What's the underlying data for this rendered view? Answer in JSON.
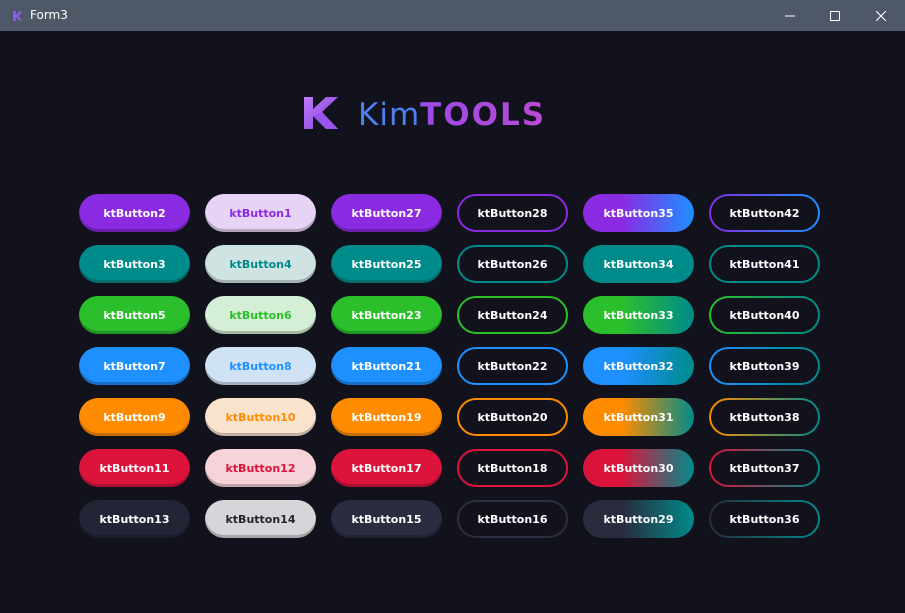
{
  "window": {
    "title": "Form3",
    "icon": "app-icon",
    "controls": [
      "minimize-icon",
      "maximize-icon",
      "close-icon"
    ]
  },
  "logo": {
    "part1": "Kim",
    "part2": "TOOLS",
    "colors": {
      "kim": "#4f7ff0",
      "tools_start": "#9a4ae6",
      "tools_end": "#b84bd4"
    }
  },
  "palette": {
    "purple": "#8a2be2",
    "teal": "#008b8b",
    "green": "#2cbf2c",
    "blue": "#1e90ff",
    "orange": "#ff8c00",
    "crimson": "#dc143c",
    "dark": "#2a2b3d"
  },
  "buttons": [
    [
      "ktButton2",
      "ktButton1",
      "ktButton27",
      "ktButton28",
      "ktButton35",
      "ktButton42"
    ],
    [
      "ktButton3",
      "ktButton4",
      "ktButton25",
      "ktButton26",
      "ktButton34",
      "ktButton41"
    ],
    [
      "ktButton5",
      "ktButton6",
      "ktButton23",
      "ktButton24",
      "ktButton33",
      "ktButton40"
    ],
    [
      "ktButton7",
      "ktButton8",
      "ktButton21",
      "ktButton22",
      "ktButton32",
      "ktButton39"
    ],
    [
      "ktButton9",
      "ktButton10",
      "ktButton19",
      "ktButton20",
      "ktButton31",
      "ktButton38"
    ],
    [
      "ktButton11",
      "ktButton12",
      "ktButton17",
      "ktButton18",
      "ktButton30",
      "ktButton37"
    ],
    [
      "ktButton13",
      "ktButton14",
      "ktButton15",
      "ktButton16",
      "ktButton29",
      "ktButton36"
    ]
  ]
}
